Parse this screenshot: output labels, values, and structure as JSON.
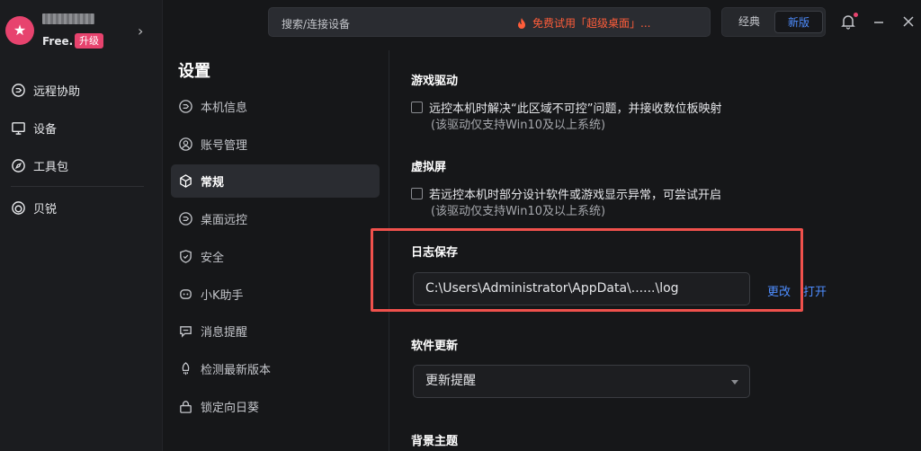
{
  "profile": {
    "plan": "Free.",
    "upgrade_label": "升级"
  },
  "nav": {
    "items": [
      {
        "label": "远程协助",
        "icon": "remote-assist-icon"
      },
      {
        "label": "设备",
        "icon": "monitor-icon"
      },
      {
        "label": "工具包",
        "icon": "compass-icon"
      },
      {
        "label": "贝锐",
        "icon": "brand-ring-icon"
      }
    ]
  },
  "topbar": {
    "search_label": "搜索/连接设备",
    "promo_text": "免费试用「超级桌面」...",
    "view_classic": "经典",
    "view_new": "新版"
  },
  "settings": {
    "title": "设置",
    "menu": [
      {
        "label": "本机信息",
        "icon": "device-info-icon"
      },
      {
        "label": "账号管理",
        "icon": "account-icon"
      },
      {
        "label": "常规",
        "icon": "cube-icon",
        "active": true
      },
      {
        "label": "桌面远控",
        "icon": "desktop-remote-icon"
      },
      {
        "label": "安全",
        "icon": "shield-icon"
      },
      {
        "label": "小K助手",
        "icon": "assistant-icon"
      },
      {
        "label": "消息提醒",
        "icon": "message-icon"
      },
      {
        "label": "检测最新版本",
        "icon": "update-icon"
      },
      {
        "label": "锁定向日葵",
        "icon": "lock-icon"
      }
    ]
  },
  "content": {
    "game_driver": {
      "title": "游戏驱动",
      "checkbox_label": "远控本机时解决“此区域不可控”问题，并接收数位板映射",
      "checked": false,
      "note": "(该驱动仅支持Win10及以上系统)"
    },
    "virtual_screen": {
      "title": "虚拟屏",
      "checkbox_label": "若远控本机时部分设计软件或游戏显示异常，可尝试开启",
      "checked": false,
      "note": "(该驱动仅支持Win10及以上系统)"
    },
    "log_save": {
      "title": "日志保存",
      "path": "C:\\Users\\Administrator\\AppData\\......\\log",
      "change_label": "更改",
      "open_label": "打开"
    },
    "software_update": {
      "title": "软件更新",
      "selected": "更新提醒"
    },
    "background_theme": {
      "title": "背景主题"
    }
  },
  "colors": {
    "accent": "#4e8dff",
    "brand_pink": "#e7436e",
    "highlight_red": "#f0514c",
    "promo_orange": "#ff5d3a"
  }
}
